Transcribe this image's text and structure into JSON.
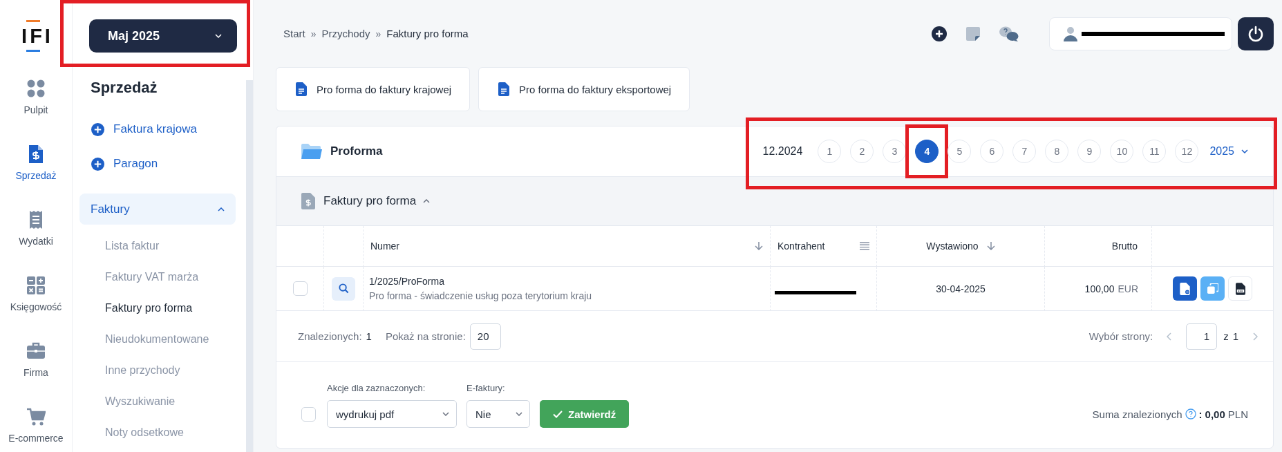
{
  "logo": {
    "text": "IFI"
  },
  "rail": [
    {
      "label": "Pulpit",
      "selected": false
    },
    {
      "label": "Sprzedaż",
      "selected": true
    },
    {
      "label": "Wydatki",
      "selected": false
    },
    {
      "label": "Księgowość",
      "selected": false
    },
    {
      "label": "Firma",
      "selected": false
    },
    {
      "label": "E-commerce",
      "selected": false
    }
  ],
  "month_picker": {
    "label": "Maj 2025",
    "highlighted": true
  },
  "sidebar": {
    "title": "Sprzedaż",
    "quick_actions": [
      {
        "label": "Faktura krajowa"
      },
      {
        "label": "Paragon"
      }
    ],
    "group": {
      "label": "Faktury",
      "expanded": true,
      "children": [
        {
          "label": "Lista faktur",
          "selected": false
        },
        {
          "label": "Faktury VAT marża",
          "selected": false
        },
        {
          "label": "Faktury pro forma",
          "selected": true
        },
        {
          "label": "Nieudokumentowane",
          "selected": false
        },
        {
          "label": "Inne przychody",
          "selected": false
        },
        {
          "label": "Wyszukiwanie",
          "selected": false
        },
        {
          "label": "Noty odsetkowe",
          "selected": false
        }
      ]
    }
  },
  "breadcrumb": {
    "separator": "»",
    "items": [
      "Start",
      "Przychody",
      "Faktury pro forma"
    ]
  },
  "user_box": {
    "redacted": true
  },
  "create_buttons": [
    {
      "label": "Pro forma do faktury krajowej"
    },
    {
      "label": "Pro forma do faktury eksportowej"
    }
  ],
  "card": {
    "title": "Proforma",
    "period_label": "12.2024",
    "months_highlighted": true,
    "months": [
      {
        "label": "1",
        "selected": false
      },
      {
        "label": "2",
        "selected": false
      },
      {
        "label": "3",
        "selected": false
      },
      {
        "label": "4",
        "selected": true,
        "highlighted": true
      },
      {
        "label": "5",
        "selected": false
      },
      {
        "label": "6",
        "selected": false
      },
      {
        "label": "7",
        "selected": false
      },
      {
        "label": "8",
        "selected": false
      },
      {
        "label": "9",
        "selected": false
      },
      {
        "label": "10",
        "selected": false
      },
      {
        "label": "11",
        "selected": false
      },
      {
        "label": "12",
        "selected": false
      }
    ],
    "year": "2025",
    "section": {
      "title": "Faktury pro forma",
      "expanded": true
    },
    "table": {
      "columns": [
        {
          "label": "Numer",
          "kind": "sortable"
        },
        {
          "label": "Kontrahent",
          "kind": "filterable"
        },
        {
          "label": "Wystawiono",
          "kind": "sortable"
        },
        {
          "label": "Brutto",
          "kind": "plain"
        }
      ],
      "rows": [
        {
          "selected": false,
          "number": "1/2025/ProForma",
          "description": "Pro forma - świadczenie usług poza terytorium kraju",
          "contractor_redacted": true,
          "issued": "30-04-2025",
          "amount": "100,00",
          "currency": "EUR"
        }
      ]
    },
    "footer": {
      "found_label": "Znalezionych:",
      "found": "1",
      "per_page_label": "Pokaż na stronie:",
      "per_page": "20",
      "page_label": "Wybór strony:",
      "page": "1",
      "of": "z",
      "pages": "1"
    },
    "bulk": {
      "checked": false,
      "actions_label": "Akcje dla zaznaczonych:",
      "action": "wydrukuj pdf",
      "efaktury_label": "E-faktury:",
      "efaktury": "Nie",
      "submit": "Zatwierdź",
      "sum_label": "Suma znalezionych",
      "sum_separator": ":",
      "sum_value": "0,00",
      "sum_currency": "PLN"
    }
  }
}
